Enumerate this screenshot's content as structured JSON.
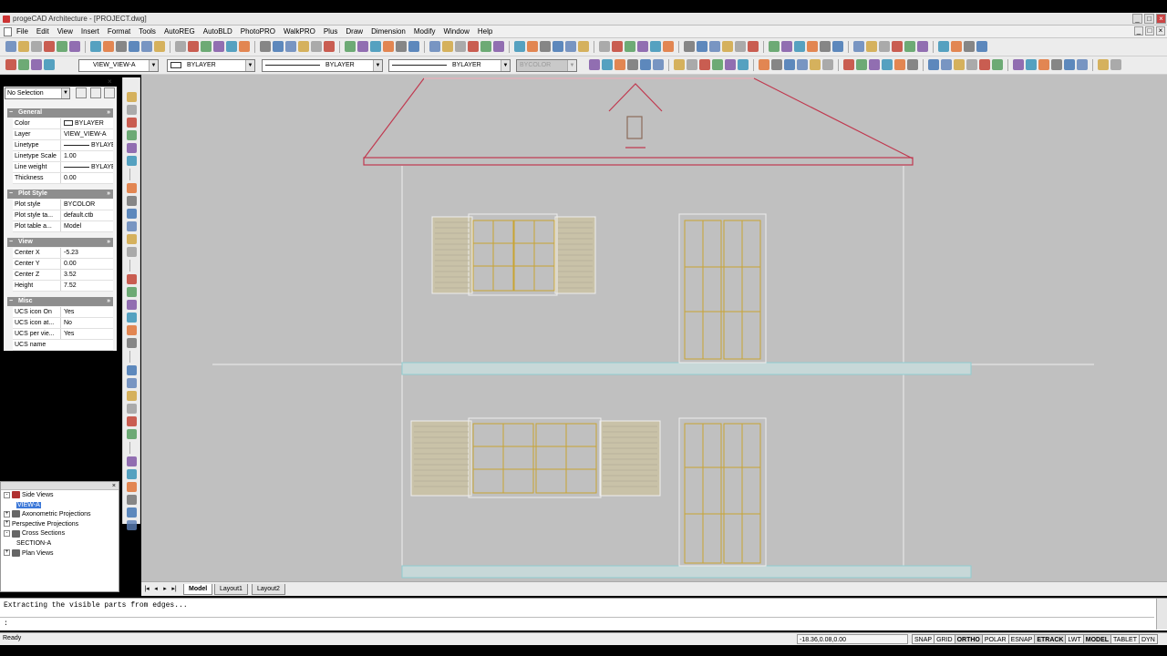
{
  "window": {
    "title": "progeCAD Architecture - [PROJECT.dwg]",
    "buttons": [
      "_",
      "□",
      "×"
    ]
  },
  "menu": {
    "items": [
      "File",
      "Edit",
      "View",
      "Insert",
      "Format",
      "Tools",
      "AutoREG",
      "AutoBLD",
      "PhotoPRO",
      "WalkPRO",
      "Plus",
      "Draw",
      "Dimension",
      "Modify",
      "Window",
      "Help"
    ],
    "mdi_buttons": [
      "_",
      "□",
      "×"
    ]
  },
  "layer_bar": {
    "layer": "VIEW_VIEW-A",
    "color": "BYLAYER",
    "linetype": "BYLAYER",
    "lineweight": "BYLAYER",
    "plotstyle": "BYCOLOR"
  },
  "properties": {
    "selection": "No Selection",
    "sections": [
      {
        "title": "General",
        "rows": [
          {
            "key": "Color",
            "value": "BYLAYER",
            "type": "swatch"
          },
          {
            "key": "Layer",
            "value": "VIEW_VIEW-A"
          },
          {
            "key": "Linetype",
            "value": "BYLAYE",
            "type": "line"
          },
          {
            "key": "Linetype Scale",
            "value": "1.00"
          },
          {
            "key": "Line weight",
            "value": "BYLAYER",
            "type": "line"
          },
          {
            "key": "Thickness",
            "value": "0.00"
          }
        ]
      },
      {
        "title": "Plot Style",
        "rows": [
          {
            "key": "Plot style",
            "value": "BYCOLOR"
          },
          {
            "key": "Plot style ta...",
            "value": "default.ctb"
          },
          {
            "key": "Plot table a...",
            "value": "Model"
          }
        ]
      },
      {
        "title": "View",
        "rows": [
          {
            "key": "Center X",
            "value": "-5.23"
          },
          {
            "key": "Center Y",
            "value": "0.00"
          },
          {
            "key": "Center Z",
            "value": "3.52"
          },
          {
            "key": "Height",
            "value": "7.52"
          }
        ]
      },
      {
        "title": "Misc",
        "rows": [
          {
            "key": "UCS icon On",
            "value": "Yes"
          },
          {
            "key": "UCS icon at...",
            "value": "No"
          },
          {
            "key": "UCS per vie...",
            "value": "Yes"
          },
          {
            "key": "UCS name",
            "value": ""
          }
        ]
      }
    ]
  },
  "views_tree": [
    {
      "label": "Side Views",
      "level": 0,
      "expander": "-",
      "icon": "red"
    },
    {
      "label": "VIEW-A",
      "level": 2,
      "selected": true
    },
    {
      "label": "Axonometric Projections",
      "level": 0,
      "expander": "+",
      "icon": "gray"
    },
    {
      "label": "Perspective Projections",
      "level": 0,
      "expander": "+"
    },
    {
      "label": "Cross Sections",
      "level": 0,
      "expander": "-",
      "icon": "gray"
    },
    {
      "label": "SECTION-A",
      "level": 2
    },
    {
      "label": "Plan Views",
      "level": 0,
      "expander": "+",
      "icon": "gray"
    }
  ],
  "layout_tabs": [
    "Model",
    "Layout1",
    "Layout2"
  ],
  "active_tab": "Model",
  "command": {
    "history": "Extracting the visible parts from edges...",
    "prompt": ":"
  },
  "status": {
    "ready": "Ready",
    "coords": "-18.36,0.08,0.00",
    "toggles": [
      "SNAP",
      "GRID",
      "ORTHO",
      "POLAR",
      "ESNAP",
      "ETRACK",
      "LWT",
      "MODEL",
      "TABLET",
      "DYN"
    ]
  },
  "colors": {
    "canvas": "#c0c0c0",
    "roof": "#c0394f",
    "outline": "#eeeeee",
    "window": "#c9a432",
    "slab": "#8fcdd0"
  }
}
